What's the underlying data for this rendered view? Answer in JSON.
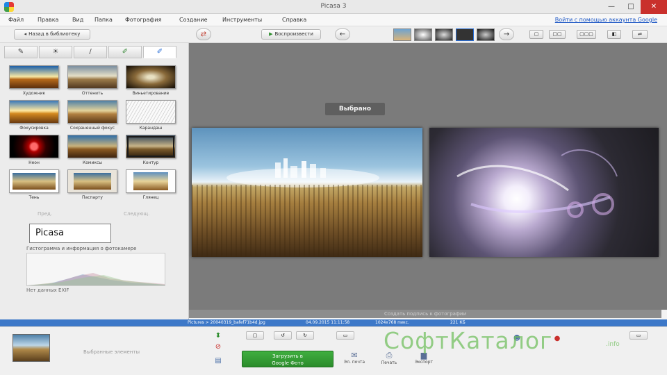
{
  "window": {
    "title": "Picasa 3",
    "minimize": "—",
    "maximize": "□",
    "close": "✕"
  },
  "menu": {
    "items": [
      "Файл",
      "Правка",
      "Вид",
      "Папка",
      "Фотография",
      "Создание",
      "Инструменты",
      "Справка"
    ],
    "signin": "Войти с помощью аккаунта Google"
  },
  "toolbar": {
    "back_to_library": "Назад в библиотеку",
    "slideshow": "Воспроизвести"
  },
  "left_panel": {
    "tabs": [
      "wrench-icon",
      "contrast-icon",
      "brush-icon",
      "brush-fill-icon",
      "brush-effects-icon"
    ],
    "effects": [
      {
        "label": "Художник"
      },
      {
        "label": "Оттенить"
      },
      {
        "label": "Виньетирование"
      },
      {
        "label": "Фокусировка"
      },
      {
        "label": "Сохраненный фокус"
      },
      {
        "label": "Карандаш"
      },
      {
        "label": "Неон"
      },
      {
        "label": "Комиксы"
      },
      {
        "label": "Контур"
      },
      {
        "label": "Тень"
      },
      {
        "label": "Паспарту"
      },
      {
        "label": "Глянец"
      }
    ],
    "pager_prev": "Пред.",
    "pager_next": "Следующ.",
    "text_field_value": "Picasa",
    "histogram_title": "Гистограмма и информация о фотокамере",
    "exif_note": "Нет данных EXIF"
  },
  "main": {
    "selected_label": "Выбрано",
    "caption_placeholder": "Создать подпись к фотографии"
  },
  "statusbar": {
    "path": "Pictures > 20040319_bafef71b4d.jpg",
    "date": "04.09.2015 11:11:58",
    "size": "1024x768 пикс.",
    "filesize": "221 КБ"
  },
  "bottom": {
    "tray_label": "Выбранные элементы",
    "upload_line1": "Загрузить в",
    "upload_line2": "Google Фото",
    "actions": [
      "Эл. почта",
      "Печать",
      "Экспорт"
    ],
    "watermark": "СофтКаталог",
    "watermark_suffix": ".info"
  },
  "colors": {
    "accent_green": "#2b8c2b",
    "status_blue": "#3d78c8",
    "close_red": "#c9302c"
  }
}
